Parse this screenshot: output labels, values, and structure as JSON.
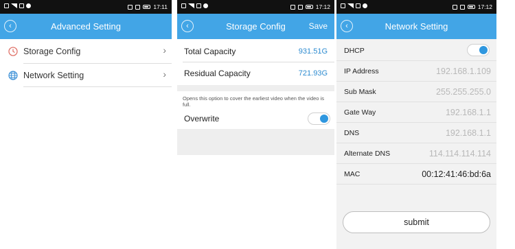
{
  "screens": {
    "advanced": {
      "status": {
        "time": "17:11"
      },
      "nav": {
        "back_icon": "chevron-left-icon",
        "title": "Advanced Setting"
      },
      "items": [
        {
          "label": "Storage Config",
          "icon": "clock-icon"
        },
        {
          "label": "Network Setting",
          "icon": "globe-icon"
        }
      ]
    },
    "storage": {
      "status": {
        "time": "17:12"
      },
      "nav": {
        "back_icon": "chevron-left-icon",
        "title": "Storage Config",
        "action": "Save"
      },
      "rows": [
        {
          "label": "Total Capacity",
          "value": "931.51G"
        },
        {
          "label": "Residual Capacity",
          "value": "721.93G"
        }
      ],
      "note": "Opens this option to cover the earliest video when the video is full.",
      "overwrite": {
        "label": "Overwrite",
        "on": true
      }
    },
    "network": {
      "status": {
        "time": "17:12"
      },
      "nav": {
        "back_icon": "chevron-left-icon",
        "title": "Network Setting"
      },
      "dhcp": {
        "label": "DHCP",
        "on": true
      },
      "rows": [
        {
          "label": "IP Address",
          "value": "192.168.1.109"
        },
        {
          "label": "Sub Mask",
          "value": "255.255.255.0"
        },
        {
          "label": "Gate Way",
          "value": "192.168.1.1"
        },
        {
          "label": "DNS",
          "value": "192.168.1.1"
        },
        {
          "label": "Alternate DNS",
          "value": "114.114.114.114"
        },
        {
          "label": "MAC",
          "value": "00:12:41:46:bd:6a"
        }
      ],
      "submit_label": "submit"
    }
  },
  "colors": {
    "accent": "#42a5e6",
    "toggle_knob": "#2f97df",
    "value_blue": "#2c8bd0",
    "status_bar": "#111111"
  }
}
